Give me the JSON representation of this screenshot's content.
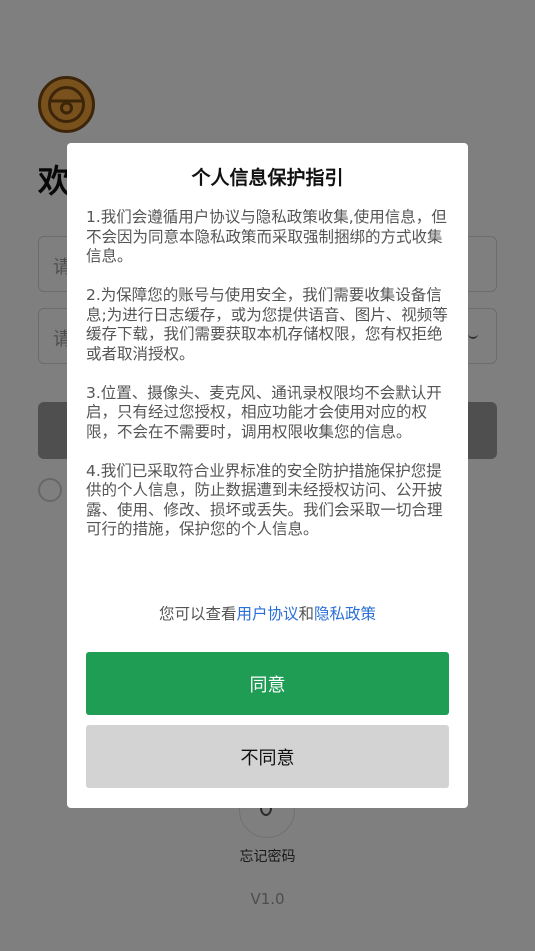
{
  "login": {
    "welcome_text": "欢",
    "account_placeholder": "请",
    "password_placeholder": "请",
    "forgot_password": "忘记密码",
    "version": "V1.0"
  },
  "dialog": {
    "title": "个人信息保护指引",
    "paragraphs": [
      "1.我们会遵循用户协议与隐私政策收集,使用信息，但不会因为同意本隐私政策而采取强制捆绑的方式收集信息。",
      "2.为保障您的账号与使用安全，我们需要收集设备信息;为进行日志缓存，或为您提供语音、图片、视频等缓存下载，我们需要获取本机存储权限，您有权拒绝或者取消授权。",
      "3.位置、摄像头、麦克风、通讯录权限均不会默认开启，只有经过您授权，相应功能才会使用对应的权限，不会在不需要时，调用权限收集您的信息。",
      "4.我们已采取符合业界标准的安全防护措施保护您提供的个人信息，防止数据遭到未经授权访问、公开披露、使用、修改、损坏或丢失。我们会采取一切合理可行的措施，保护您的个人信息。"
    ],
    "links_prefix": "您可以查看",
    "user_agreement": "用户协议",
    "links_and": "和",
    "privacy_policy": "隐私政策",
    "agree_label": "同意",
    "disagree_label": "不同意"
  },
  "colors": {
    "accent_green": "#1f9d55",
    "link_blue": "#2a6fd6",
    "logo_orange": "#f2a33a"
  }
}
